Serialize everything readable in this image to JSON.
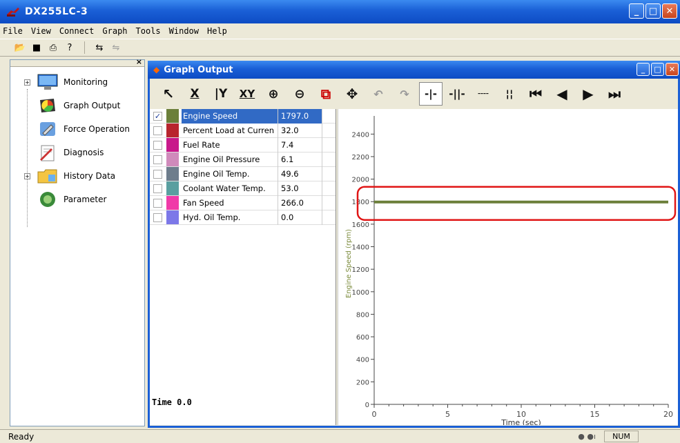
{
  "app": {
    "title": "DX255LC-3",
    "menu": [
      "File",
      "View",
      "Connect",
      "Graph",
      "Tools",
      "Window",
      "Help"
    ]
  },
  "tree": {
    "items": [
      {
        "label": "Monitoring",
        "expandable": true,
        "icon": "monitor-icon"
      },
      {
        "label": "Graph Output",
        "expandable": false,
        "icon": "graph-icon"
      },
      {
        "label": "Force Operation",
        "expandable": false,
        "icon": "wrench-icon"
      },
      {
        "label": "Diagnosis",
        "expandable": false,
        "icon": "diagnosis-icon"
      },
      {
        "label": "History Data",
        "expandable": true,
        "icon": "folder-icon"
      },
      {
        "label": "Parameter",
        "expandable": false,
        "icon": "parameter-icon"
      }
    ]
  },
  "graph_window": {
    "title": "Graph Output",
    "time_label": "Time 0.0",
    "signals": [
      {
        "name": "Engine Speed",
        "value": "1797.0",
        "color": "#6b7f3a",
        "checked": true,
        "selected": true
      },
      {
        "name": "Percent Load at Curren",
        "value": "32.0",
        "color": "#b8252e",
        "checked": false
      },
      {
        "name": "Fuel Rate",
        "value": "7.4",
        "color": "#c8188a",
        "checked": false
      },
      {
        "name": "Engine Oil Pressure",
        "value": "6.1",
        "color": "#d08abb",
        "checked": false
      },
      {
        "name": "Engine Oil Temp.",
        "value": "49.6",
        "color": "#6e7d8c",
        "checked": false
      },
      {
        "name": "Coolant Water Temp.",
        "value": "53.0",
        "color": "#5a9fa0",
        "checked": false
      },
      {
        "name": "Fan Speed",
        "value": "266.0",
        "color": "#f03aa8",
        "checked": false
      },
      {
        "name": "Hyd. Oil Temp.",
        "value": "0.0",
        "color": "#7c78e8",
        "checked": false
      }
    ]
  },
  "chart_data": {
    "type": "line",
    "xlabel": "Time (sec)",
    "ylabel": "Engine Speed (rpm)",
    "xlim": [
      0,
      20
    ],
    "ylim": [
      0,
      2500
    ],
    "xticks": [
      "0",
      "5",
      "10",
      "15",
      "20"
    ],
    "yticks": [
      "0",
      "200",
      "400",
      "600",
      "800",
      "1000",
      "1200",
      "1400",
      "1600",
      "1800",
      "2000",
      "2200",
      "2400"
    ],
    "series": [
      {
        "name": "Engine Speed",
        "color": "#6b7f3a",
        "x": [
          0,
          20
        ],
        "y": [
          1797,
          1797
        ]
      }
    ]
  },
  "status": {
    "text": "Ready",
    "num": "NUM"
  }
}
